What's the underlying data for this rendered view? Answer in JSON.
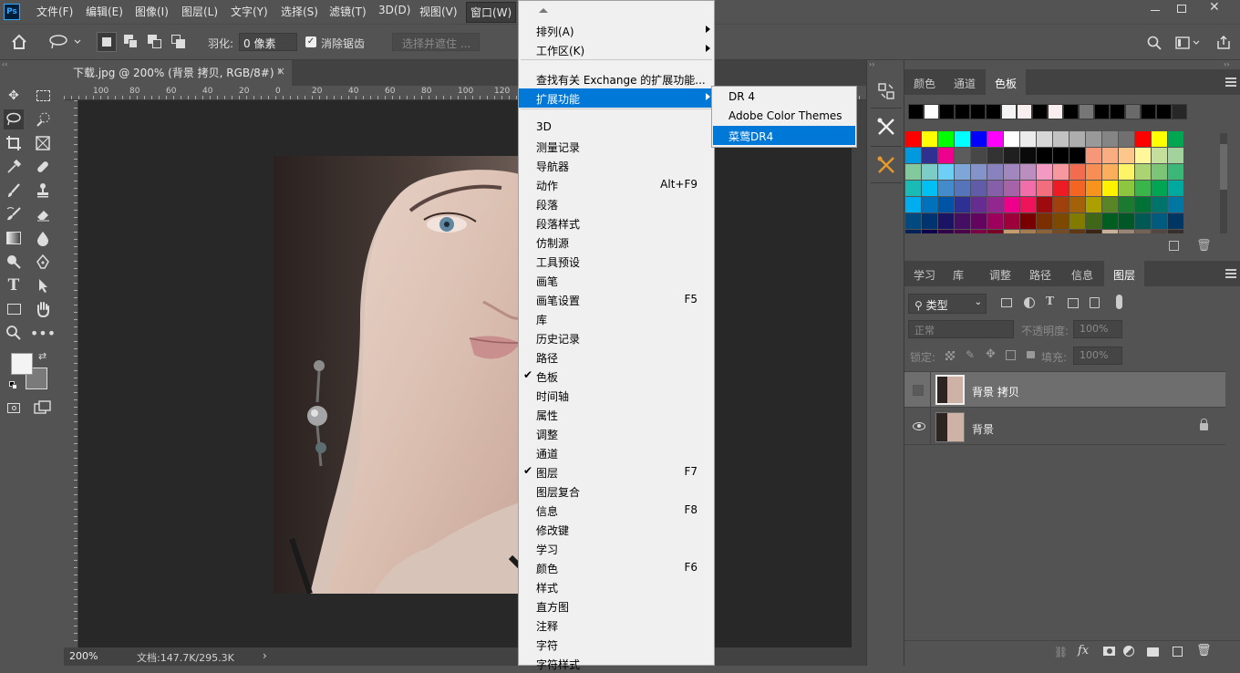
{
  "app": {
    "logo": "Ps"
  },
  "menubar": {
    "items": [
      "文件(F)",
      "编辑(E)",
      "图像(I)",
      "图层(L)",
      "文字(Y)",
      "选择(S)",
      "滤镜(T)",
      "3D(D)",
      "视图(V)",
      "窗口(W)"
    ],
    "window_controls": [
      "minimize",
      "restore",
      "close"
    ]
  },
  "options": {
    "feather_label": "羽化:",
    "feather_value": "0 像素",
    "antialias_label": "消除锯齿",
    "antialias_checked": true,
    "select_mask_label": "选择并遮住 ..."
  },
  "document": {
    "tab_title": "下载.jpg @ 200% (背景 拷贝, RGB/8#) *",
    "close_glyph": "×",
    "ruler_h": [
      "100",
      "80",
      "60",
      "40",
      "20",
      "0",
      "20",
      "40",
      "60",
      "80",
      "100",
      "120"
    ],
    "ruler_v": [
      "2\n0",
      "0",
      "2\n0",
      "4\n0",
      "6\n0",
      "8\n0",
      "1\n0\n0",
      "1\n2\n0",
      "1\n4\n0",
      "1\n6\n0",
      "1\n8\n0",
      "2\n0\n0",
      "2\n2\n0",
      "2\n4\n0",
      "2\n6\n0"
    ],
    "zoom": "200%",
    "doc_info": "文档:147.7K/295.3K",
    "status_arrow": "›"
  },
  "window_menu": {
    "items": [
      {
        "label": "排列(A)",
        "submenu": true
      },
      {
        "label": "工作区(K)",
        "submenu": true
      },
      {
        "sep": true
      },
      {
        "label": "查找有关 Exchange 的扩展功能..."
      },
      {
        "label": "扩展功能",
        "submenu": true,
        "highlight": true
      },
      {
        "sep": true
      },
      {
        "label": "3D"
      },
      {
        "label": "测量记录"
      },
      {
        "label": "导航器"
      },
      {
        "label": "动作",
        "shortcut": "Alt+F9"
      },
      {
        "label": "段落"
      },
      {
        "label": "段落样式"
      },
      {
        "label": "仿制源"
      },
      {
        "label": "工具预设"
      },
      {
        "label": "画笔"
      },
      {
        "label": "画笔设置",
        "shortcut": "F5"
      },
      {
        "label": "库"
      },
      {
        "label": "历史记录"
      },
      {
        "label": "路径"
      },
      {
        "label": "色板",
        "checked": true
      },
      {
        "label": "时间轴"
      },
      {
        "label": "属性"
      },
      {
        "label": "调整"
      },
      {
        "label": "通道"
      },
      {
        "label": "图层",
        "checked": true,
        "shortcut": "F7"
      },
      {
        "label": "图层复合"
      },
      {
        "label": "信息",
        "shortcut": "F8"
      },
      {
        "label": "修改键"
      },
      {
        "label": "学习"
      },
      {
        "label": "颜色",
        "shortcut": "F6"
      },
      {
        "label": "样式"
      },
      {
        "label": "直方图"
      },
      {
        "label": "注释"
      },
      {
        "label": "字符"
      },
      {
        "label": "字符样式"
      }
    ],
    "checkmark": "✔"
  },
  "extensions_submenu": {
    "items": [
      {
        "label": "DR 4"
      },
      {
        "label": "Adobe Color Themes"
      },
      {
        "label": "菜莺DR4",
        "highlight": true
      }
    ]
  },
  "color_panel": {
    "tabs": [
      "颜色",
      "通道",
      "色板"
    ],
    "active_tab": "色板",
    "recent_swatches": [
      "#000000",
      "#ffffff",
      "#000000",
      "#000000",
      "#000000",
      "#000000",
      "#f4f4f4",
      "#f8eef0",
      "#000000",
      "#f8eef0",
      "#000000",
      "#767676",
      "#000000",
      "#000000",
      "#6a6a6a",
      "#000000",
      "#000000",
      "#272727"
    ],
    "swatch_rows": [
      [
        "#ff0000",
        "#ffff00",
        "#00ff00",
        "#00ffff",
        "#0000ff",
        "#ff00ff",
        "#ffffff",
        "#ebebeb",
        "#d6d6d6",
        "#c2c2c2",
        "#adadad",
        "#999999",
        "#858585",
        "#707070",
        "#ff0000",
        "#ffff00",
        "#00a651"
      ],
      [
        "#0099e0",
        "#2e3192",
        "#ec008c",
        "#5c5c5c",
        "#474747",
        "#333333",
        "#1f1f1f",
        "#0a0a0a",
        "#000000",
        "#000000",
        "#000000",
        "#f7977a",
        "#f9ad81",
        "#fdc68a",
        "#fff79a",
        "#c4df9b",
        "#a2d39c"
      ],
      [
        "#82ca9d",
        "#7bcdc8",
        "#6ecff6",
        "#7ea7d8",
        "#8493ca",
        "#8882be",
        "#a187be",
        "#bc8dbf",
        "#f49ac2",
        "#f6989d",
        "#f26c4f",
        "#f68e55",
        "#fbaf5c",
        "#fff467",
        "#acd372",
        "#7cc576",
        "#3bb878"
      ],
      [
        "#1abbb4",
        "#00bff3",
        "#438ccb",
        "#5574b9",
        "#605ca8",
        "#855fa8",
        "#a763a8",
        "#f06ea9",
        "#f26d7d",
        "#ed1c24",
        "#f26522",
        "#f7941d",
        "#fff200",
        "#8dc63f",
        "#39b54a",
        "#00a651",
        "#00a99d"
      ],
      [
        "#00aeef",
        "#0072bc",
        "#0054a6",
        "#2e3192",
        "#662d91",
        "#92278f",
        "#ec008c",
        "#ed145b",
        "#9e0b0f",
        "#a0410d",
        "#a36209",
        "#aba000",
        "#598527",
        "#1a7b30",
        "#007236",
        "#00746b",
        "#0076a3"
      ],
      [
        "#004a80",
        "#003471",
        "#1b1464",
        "#440e62",
        "#630460",
        "#9e005d",
        "#9e0039",
        "#790000",
        "#7b2e00",
        "#7d4900",
        "#827b00",
        "#406618",
        "#005e20",
        "#005826",
        "#005952",
        "#005b7f",
        "#003663"
      ],
      [
        "#002157",
        "#0d004c",
        "#32004b",
        "#4b0049",
        "#7b0046",
        "#7a0026",
        "#c69c6d",
        "#a67c52",
        "#8c6239",
        "#754c24",
        "#603913",
        "#3c2415",
        "#c7b299",
        "#998675",
        "#736357",
        "#534741",
        "#362f2d"
      ]
    ]
  },
  "layers_panel": {
    "tabs": [
      "学习",
      "库",
      "调整",
      "路径",
      "信息",
      "图层"
    ],
    "active_tab": "图层",
    "filter_label": "类型",
    "blend_mode": "正常",
    "opacity_label": "不透明度:",
    "opacity_value": "100%",
    "lock_label": "锁定:",
    "fill_label": "填充:",
    "fill_value": "100%",
    "layers": [
      {
        "name": "背景 拷贝",
        "visible": false,
        "selected": true,
        "locked": false
      },
      {
        "name": "背景",
        "visible": true,
        "selected": false,
        "locked": true
      }
    ],
    "footer_icons": [
      "link-icon",
      "fx-icon",
      "mask-icon",
      "adjustment-icon",
      "group-icon",
      "new-layer-icon",
      "trash-icon"
    ],
    "fx_label": "fx"
  },
  "colors": {
    "accent": "#0078d7",
    "bg": "#535353",
    "canvas": "#282828",
    "menu_bg": "#f0f0f0"
  }
}
